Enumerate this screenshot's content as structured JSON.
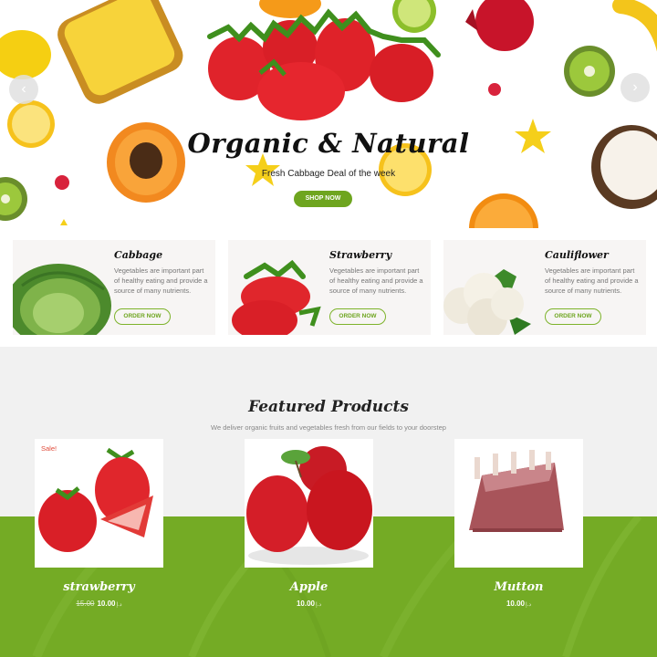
{
  "hero": {
    "title": "Organic & Natural",
    "subtitle": "Fresh Cabbage Deal of the week",
    "button": "SHOP NOW",
    "prev_icon": "chevron-left-icon",
    "next_icon": "chevron-right-icon",
    "prev_glyph": "‹",
    "next_glyph": "›"
  },
  "categories": [
    {
      "title": "Cabbage",
      "text": "Vegetables are important part of healthy eating and provide a source of many nutrients.",
      "button": "ORDER NOW"
    },
    {
      "title": "Strawberry",
      "text": "Vegetables are important part of healthy eating and provide a source of many nutrients.",
      "button": "ORDER NOW"
    },
    {
      "title": "Cauliflower",
      "text": "Vegetables are important part of healthy eating and provide a source of many nutrients.",
      "button": "ORDER NOW"
    }
  ],
  "featured": {
    "title": "Featured Products",
    "subtitle": "We deliver organic fruits and vegetables fresh from our fields to your doorstep"
  },
  "products": [
    {
      "name": "strawberry",
      "sale": "Sale!",
      "old_price": "15.00",
      "price": "10.00",
      "currency": "د.إ"
    },
    {
      "name": "Apple",
      "price": "10.00",
      "currency": "د.إ"
    },
    {
      "name": "Mutton",
      "price": "10.00",
      "currency": "د.إ"
    }
  ],
  "colors": {
    "accent": "#6ea51f",
    "green_band": "#74ab25",
    "sale": "#e04b3a",
    "card_bg": "#f7f5f4"
  }
}
